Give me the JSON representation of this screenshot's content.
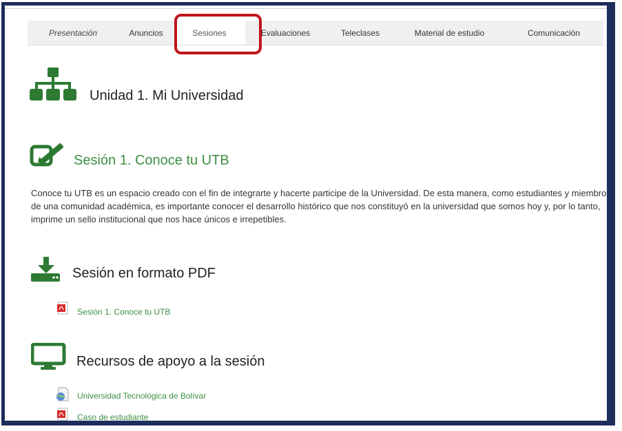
{
  "tabs": [
    {
      "label": "Presentación",
      "italic": true
    },
    {
      "label": "Anuncios"
    },
    {
      "label": "Sesiones",
      "active": true
    },
    {
      "label": "Evaluaciones"
    },
    {
      "label": "Teleclases"
    },
    {
      "label": "Material de estudio"
    },
    {
      "label": "Comunicación"
    }
  ],
  "unit": {
    "title": "Unidad 1. Mi Universidad",
    "icon": "sitemap-icon"
  },
  "session": {
    "title": "Sesión 1. Conoce tu UTB",
    "icon": "edit-icon",
    "description": "Conoce tu UTB es un espacio creado con el fin de integrarte y hacerte participe de la Universidad. De esta manera, como estudiantes y miembros de una comunidad académica, es importante conocer el desarrollo histórico que nos constituyó en la universidad que somos hoy y, por lo tanto, imprime un sello institucional que nos hace únicos e irrepetibles."
  },
  "pdf_section": {
    "title": "Sesión en formato PDF",
    "icon": "download-icon",
    "links": [
      {
        "label": "Sesión 1. Conoce tu UTB",
        "icon": "pdf-icon"
      }
    ]
  },
  "resources_section": {
    "title": "Recursos de apoyo a la sesión",
    "icon": "monitor-icon",
    "links": [
      {
        "label": "Universidad Tecnológica de Bolívar",
        "icon": "web-page-icon"
      },
      {
        "label": "Caso de estudiante",
        "icon": "pdf-icon"
      }
    ]
  },
  "colors": {
    "accent_green": "#2d7a33",
    "link_green": "#3c8f44",
    "frame_navy": "#1d2d5c",
    "highlight_red": "#c0141c"
  }
}
